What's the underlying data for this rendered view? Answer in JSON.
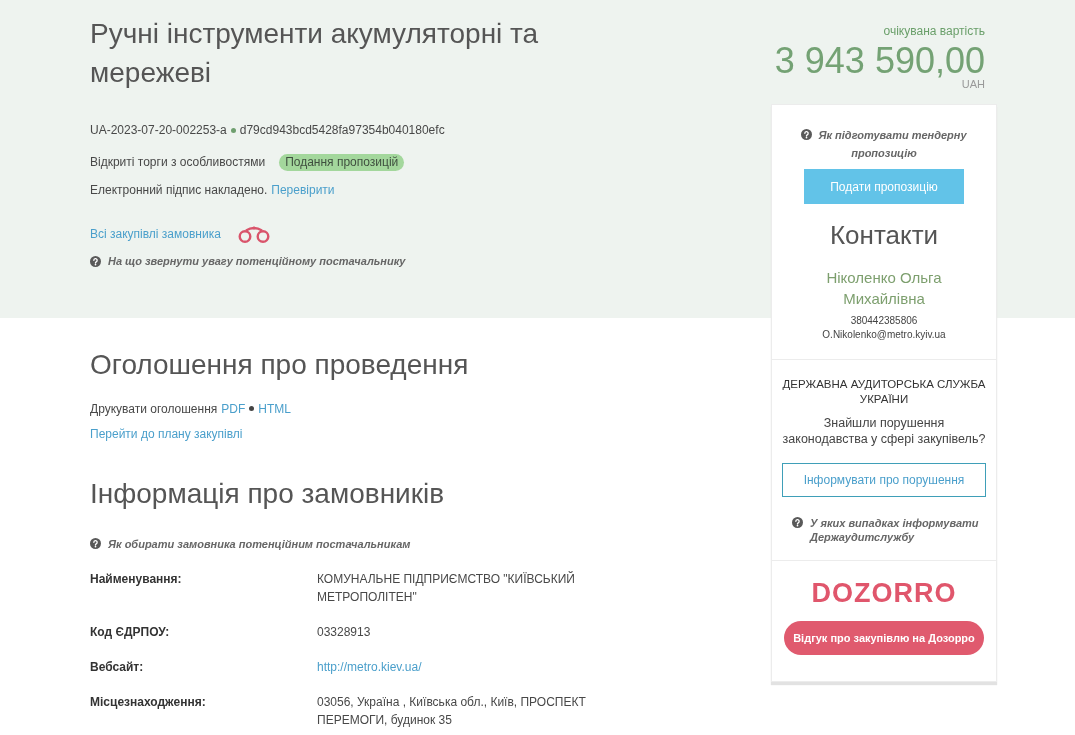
{
  "header": {
    "title": "Ручні інструменти акумуляторні та мережеві",
    "tender_id": "UA-2023-07-20-002253-a",
    "hash": "d79cd943bcd5428fa97354b040180efc",
    "procedure": "Відкриті торги з особливостями",
    "status_badge": "Подання пропозицій",
    "signature": {
      "text": "Електронний підпис накладено.",
      "link": "Перевірити"
    },
    "buyer_link": "Всі закупівлі замовника",
    "help": "На що звернути увагу потенційному постачальнику"
  },
  "price": {
    "label": "очікувана вартість",
    "amount": "3 943 590,00",
    "currency": "UAH"
  },
  "announcement": {
    "heading": "Оголошення про проведення",
    "print_label": "Друкувати оголошення",
    "print_links": [
      "PDF",
      "HTML"
    ],
    "plan_link": "Перейти до плану закупівлі"
  },
  "buyers": {
    "heading": "Інформація про замовників",
    "help": "Як обирати замовника потенційним постачальникам",
    "fields": [
      {
        "label": "Найменування:",
        "value": "КОМУНАЛЬНЕ ПІДПРИЄМСТВО \"КИЇВСЬКИЙ МЕТРОПОЛІТЕН\"",
        "kind": "text"
      },
      {
        "label": "Код ЄДРПОУ:",
        "value": "03328913",
        "kind": "text"
      },
      {
        "label": "Вебсайт:",
        "value": "http://metro.kiev.ua/",
        "kind": "link"
      },
      {
        "label": "Місцезнаходження:",
        "value": "03056, Україна , Київська обл., Київ, ПРОСПЕКТ ПЕРЕМОГИ, будинок 35",
        "kind": "text"
      }
    ]
  },
  "sidebar": {
    "help": "Як підготувати тендерну пропозицію",
    "submit_button": "Подати пропозицію",
    "contacts": {
      "heading": "Контакти",
      "name": "Ніколенко Ольга Михайлівна",
      "phone": "380442385806",
      "email": "O.Nikolenko@metro.kyiv.ua"
    },
    "audit": {
      "heading": "ДЕРЖАВНА АУДИТОРСЬКА СЛУЖБА УКРАЇНИ",
      "question": "Знайшли порушення законодавства у сфері закупівель?",
      "button": "Інформувати про порушення",
      "help": "У яких випадках інформувати Держаудитслужбу"
    },
    "dozorro": {
      "logo": "DOZORRO",
      "button": "Відгук про закупівлю на Дозорро"
    }
  }
}
